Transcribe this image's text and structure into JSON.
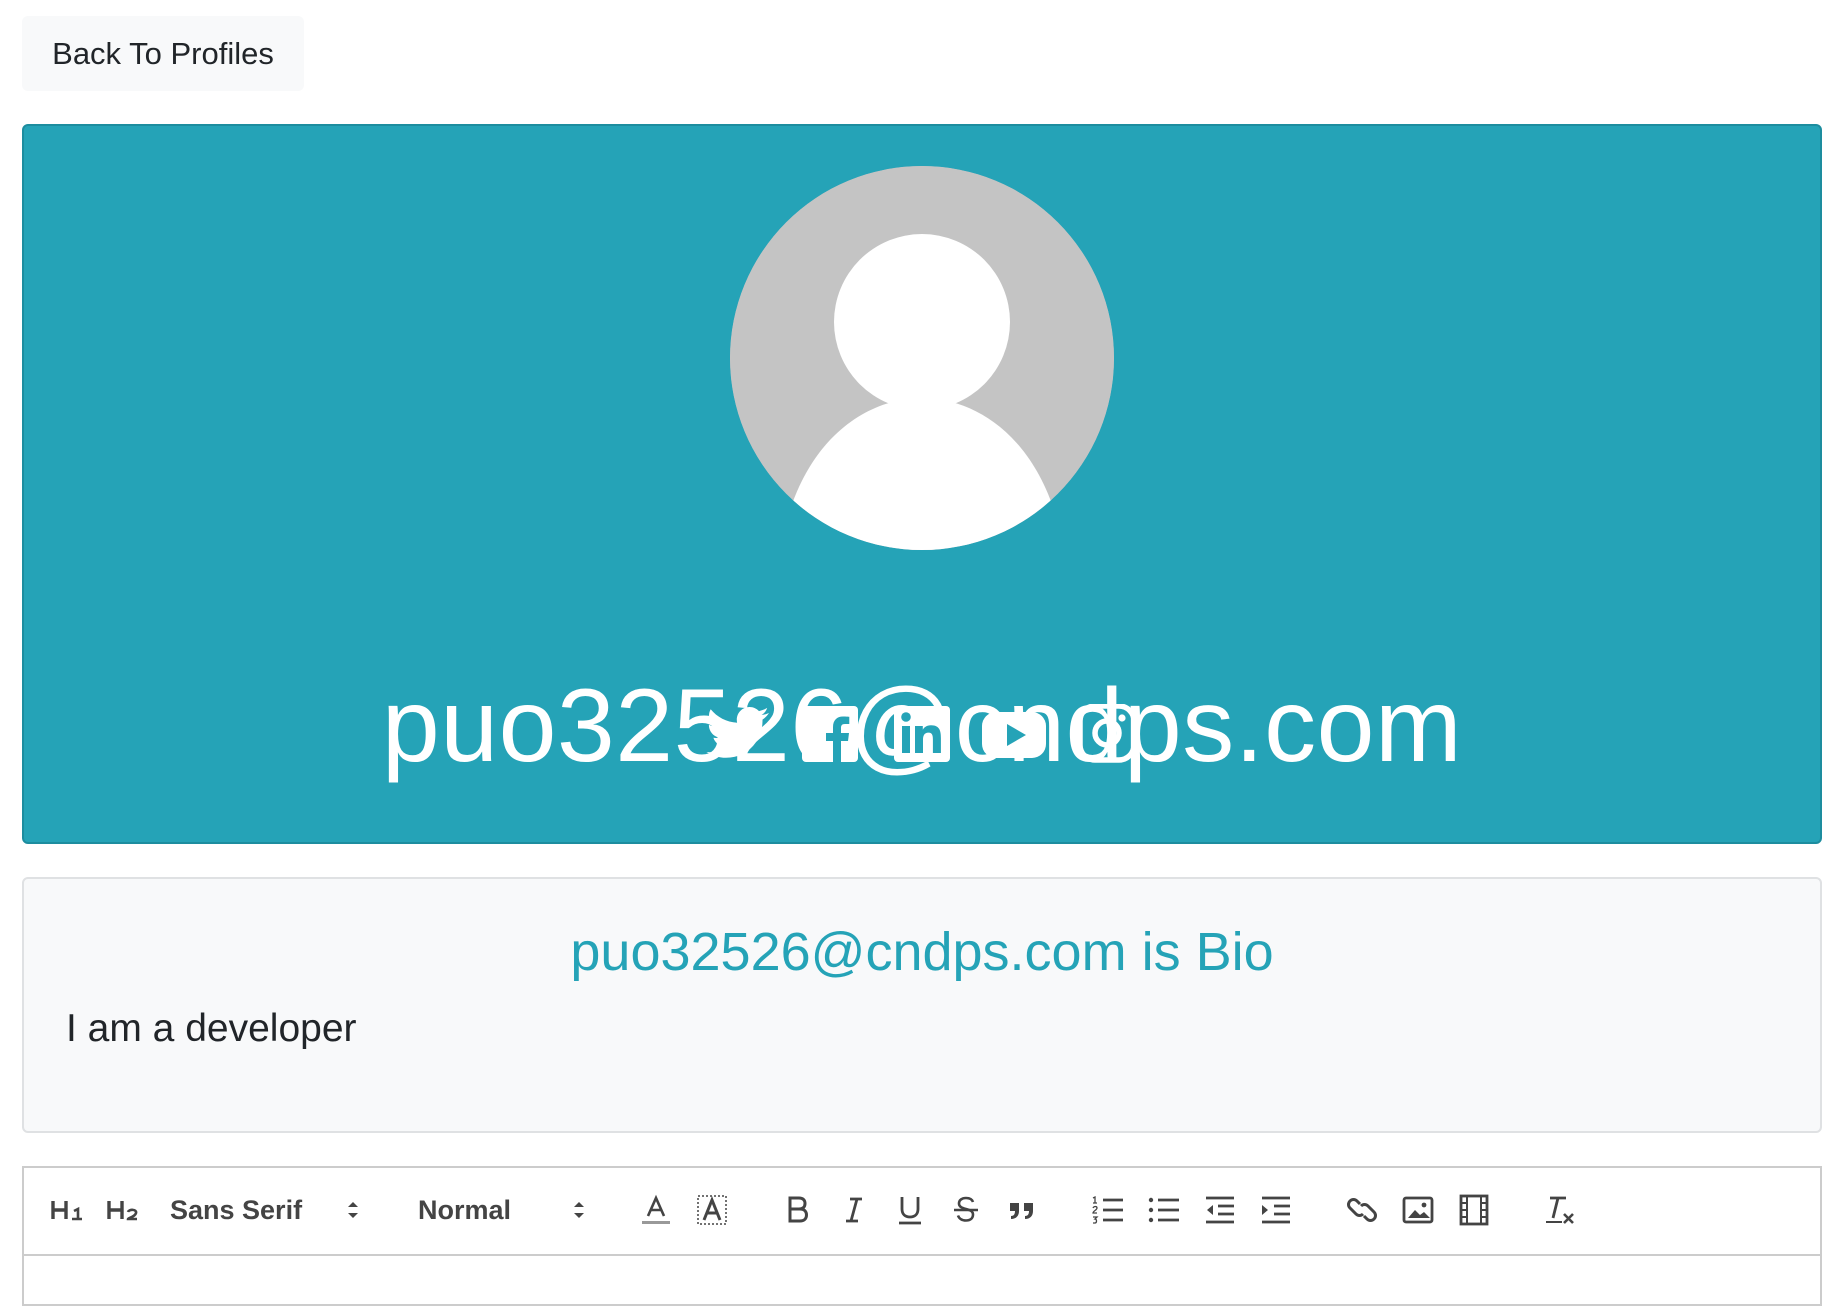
{
  "back_button": {
    "label": "Back To Profiles"
  },
  "hero": {
    "name": "puo32526@cndps.com",
    "background_color": "#25a3b7",
    "social_icons": [
      "twitter-icon",
      "facebook-icon",
      "linkedin-icon",
      "youtube-icon",
      "instagram-icon"
    ]
  },
  "bio": {
    "title": "puo32526@cndps.com is Bio",
    "text": "I am a developer"
  },
  "editor": {
    "toolbar": {
      "h1": "H1",
      "h2": "H2",
      "font_picker": "Sans Serif",
      "size_picker": "Normal",
      "icons": [
        "text-color-icon",
        "background-color-icon",
        "bold-icon",
        "italic-icon",
        "underline-icon",
        "strikethrough-icon",
        "blockquote-icon",
        "ordered-list-icon",
        "bullet-list-icon",
        "outdent-icon",
        "indent-icon",
        "link-icon",
        "image-icon",
        "video-icon",
        "clear-format-icon"
      ]
    }
  }
}
